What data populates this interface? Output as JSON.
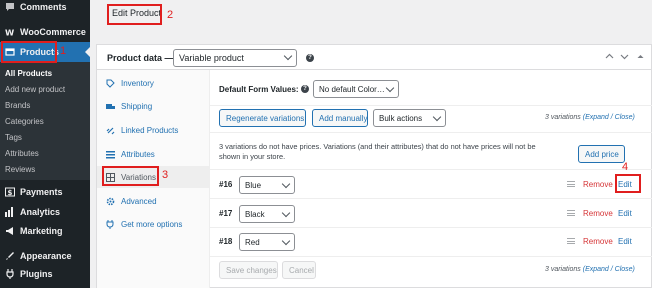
{
  "sidebar": {
    "items": [
      {
        "label": "Comments",
        "icon": "comments-icon"
      },
      {
        "label": "WooCommerce",
        "icon": "woocommerce-icon"
      },
      {
        "label": "Products",
        "icon": "products-icon"
      },
      {
        "label": "Payments",
        "icon": "payments-icon"
      },
      {
        "label": "Analytics",
        "icon": "analytics-icon"
      },
      {
        "label": "Marketing",
        "icon": "marketing-icon"
      },
      {
        "label": "Appearance",
        "icon": "appearance-icon"
      },
      {
        "label": "Plugins",
        "icon": "plugins-icon"
      }
    ],
    "submenu": [
      "All Products",
      "Add new product",
      "Brands",
      "Categories",
      "Tags",
      "Attributes",
      "Reviews"
    ]
  },
  "header": {
    "title": "Edit Product"
  },
  "product_data": {
    "label": "Product data —",
    "type_value": "Variable product",
    "tabs": [
      "Inventory",
      "Shipping",
      "Linked Products",
      "Attributes",
      "Variations",
      "Advanced",
      "Get more options"
    ]
  },
  "variations": {
    "default_form_label": "Default Form Values:",
    "default_form_value": "No default Color…",
    "buttons": {
      "regenerate": "Regenerate variations",
      "add_manually": "Add manually",
      "bulk_actions": "Bulk actions",
      "add_price": "Add price",
      "save_changes": "Save changes",
      "cancel": "Cancel"
    },
    "count_text": "3 variations",
    "expand_close": "(Expand / Close)",
    "notice": "3 variations do not have prices. Variations (and their attributes) that do not have prices will not be shown in your store.",
    "rows": [
      {
        "num": "#16",
        "value": "Blue"
      },
      {
        "num": "#17",
        "value": "Black"
      },
      {
        "num": "#18",
        "value": "Red"
      }
    ],
    "remove_label": "Remove",
    "edit_label": "Edit"
  },
  "annotations": [
    "1",
    "2",
    "3",
    "4"
  ],
  "colors": {
    "accent": "#2271b1",
    "sidebar": "#1d2327",
    "annotation": "#e01e1e",
    "remove": "#d63638"
  }
}
